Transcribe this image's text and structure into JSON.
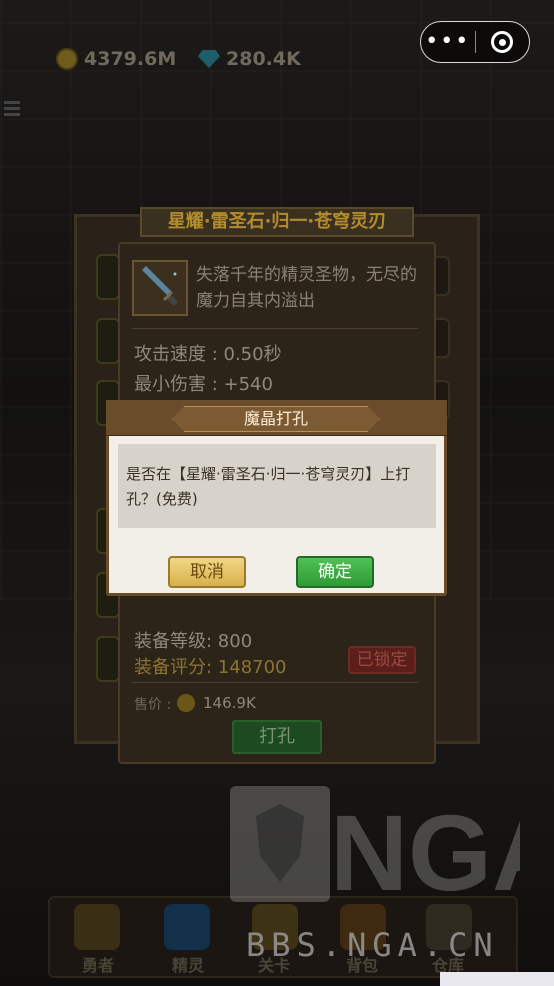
{
  "top_bar": {
    "gold": "4379.6M",
    "gems": "280.4K",
    "capsule_more": "•••"
  },
  "item_panel": {
    "title": "星耀·雷圣石·归一·苍穹灵刃",
    "description": "失落千年的精灵圣物，无尽的魔力自其内溢出",
    "stats": [
      {
        "label": "攻击速度 : 0.50秒"
      },
      {
        "label": "最小伤害 : +540"
      }
    ],
    "equip_level": "装备等级: 800",
    "equip_score": "装备评分: 148700",
    "locked": "已锁定",
    "price_label": "售价 :",
    "price_value": "146.9K",
    "punch_button": "打孔"
  },
  "dialog": {
    "title": "魔晶打孔",
    "message": "是否在【星耀·雷圣石·归一·苍穹灵刃】上打孔？(免费)",
    "cancel": "取消",
    "confirm": "确定"
  },
  "bottom_nav": [
    {
      "label": "勇者"
    },
    {
      "label": "精灵"
    },
    {
      "label": "关卡"
    },
    {
      "label": "背包"
    },
    {
      "label": "仓库"
    }
  ],
  "watermark": {
    "site": "BBS.NGA.CN"
  },
  "colors": {
    "dialog_frame": "#6b4c2a",
    "cancel_button": "#e0bb5a",
    "confirm_button": "#3aab40"
  }
}
